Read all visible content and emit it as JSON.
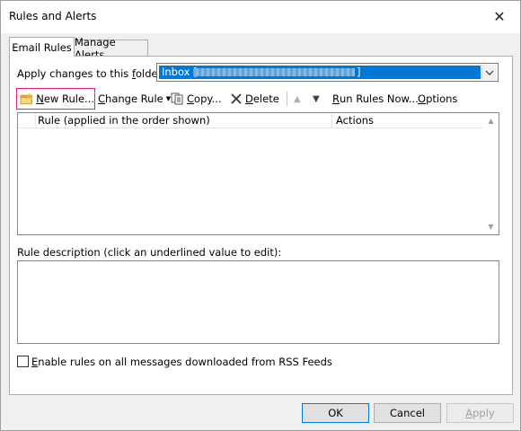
{
  "window": {
    "title": "Rules and Alerts"
  },
  "tabs": [
    {
      "label": "Email Rules",
      "active": true
    },
    {
      "label": "Manage Alerts",
      "active": false
    }
  ],
  "folder": {
    "label_pre": "Apply changes to this ",
    "label_accel": "f",
    "label_post": "older:",
    "value_prefix": "Inbox [",
    "value_suffix": "]"
  },
  "toolbar": {
    "new_rule": {
      "accel": "N",
      "rest": "ew Rule..."
    },
    "change_rule": {
      "accel": "C",
      "rest": "hange Rule"
    },
    "copy": {
      "accel": "C",
      "rest": "opy..."
    },
    "delete": {
      "accel": "D",
      "rest": "elete"
    },
    "run_rules": {
      "accel": "R",
      "rest": "un Rules Now..."
    },
    "options": {
      "accel": "O",
      "rest": "ptions"
    }
  },
  "rules_list": {
    "columns": [
      "Rule (applied in the order shown)",
      "Actions"
    ],
    "rows": []
  },
  "description": {
    "label": "Rule description (click an underlined value to edit):"
  },
  "rss": {
    "checked": false,
    "label_accel": "E",
    "label_rest": "nable rules on all messages downloaded from RSS Feeds"
  },
  "buttons": {
    "ok": "OK",
    "cancel": "Cancel",
    "apply_accel": "A",
    "apply_rest": "pply"
  },
  "colors": {
    "selection": "#0078d7",
    "highlight_border": "#e0218a"
  },
  "icons": {
    "close": "close-icon",
    "new_rule": "new-rule-icon",
    "copy": "copy-icon",
    "delete": "delete-icon",
    "move_up": "move-up-icon",
    "move_down": "move-down-icon",
    "dropdown": "chevron-down-icon"
  }
}
